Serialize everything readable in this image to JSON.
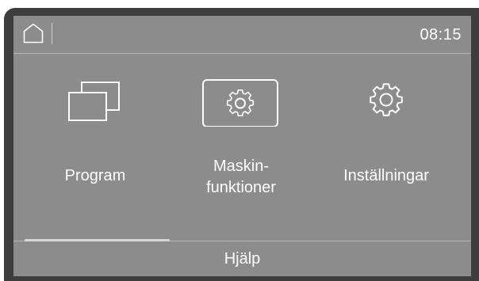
{
  "header": {
    "home_icon": "home-icon",
    "time": "08:15"
  },
  "tiles": [
    {
      "icon": "windows-stack-icon",
      "label": "Program",
      "selected": false
    },
    {
      "icon": "gear-icon",
      "label_line1": "Maskin-",
      "label_line2": "funktioner",
      "selected": true
    },
    {
      "icon": "gear-icon",
      "label": "Inställningar",
      "selected": false
    }
  ],
  "footer": {
    "help_label": "Hjälp",
    "scroll_position": 0.33
  },
  "colors": {
    "screen_background": "#8c8c8c",
    "bezel": "#3d3d3d",
    "foreground": "#ffffff"
  }
}
